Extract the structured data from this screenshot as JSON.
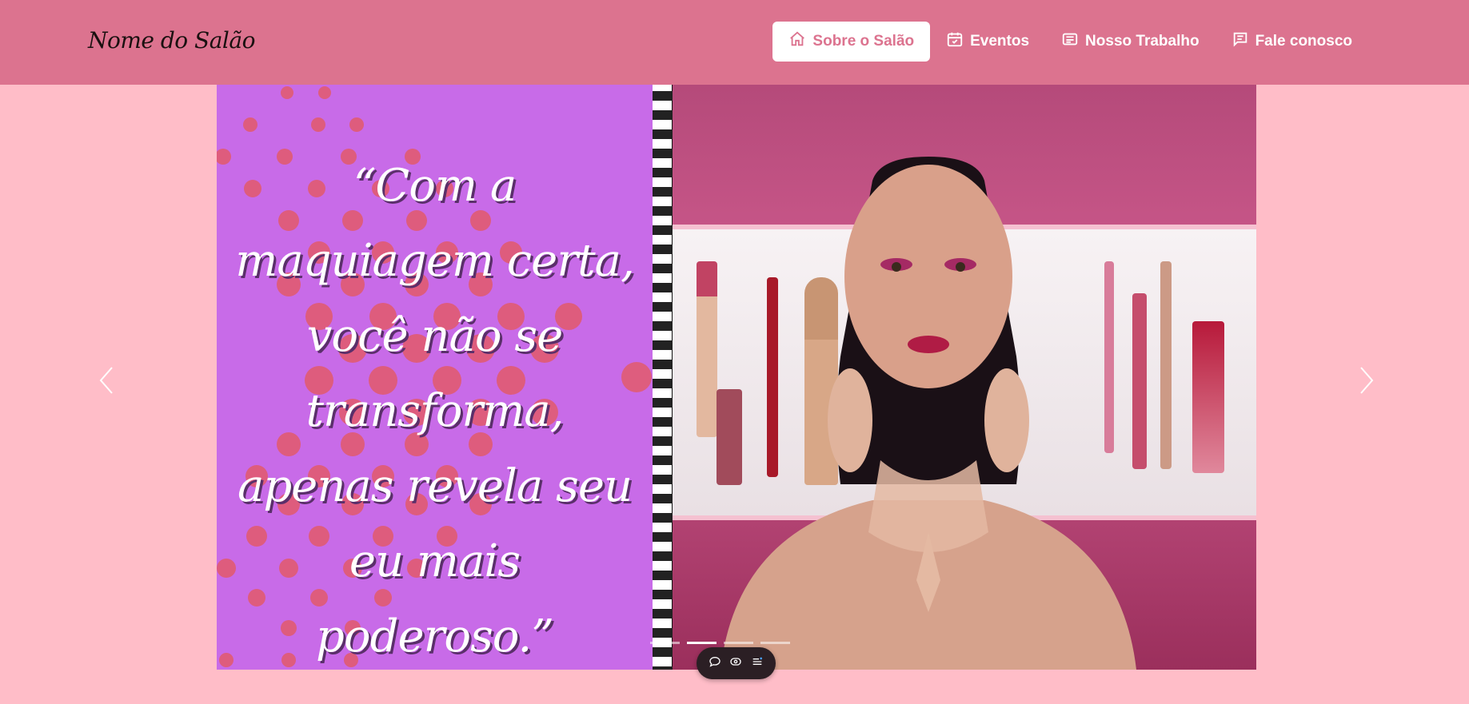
{
  "header": {
    "brand": "Nome do Salão",
    "nav": [
      {
        "label": "Sobre o Salão",
        "icon": "home-icon",
        "active": true
      },
      {
        "label": "Eventos",
        "icon": "calendar-check-icon",
        "active": false
      },
      {
        "label": "Nosso Trabalho",
        "icon": "newspaper-icon",
        "active": false
      },
      {
        "label": "Fale conosco",
        "icon": "chat-icon",
        "active": false
      }
    ]
  },
  "carousel": {
    "quote": "“Com a maquiagem certa, você não se transforma, apenas revela seu eu mais poderoso.”",
    "prev_icon": "chevron-left-icon",
    "next_icon": "chevron-right-icon",
    "indicators_count": 4,
    "active_indicator": 1
  },
  "toolbar": {
    "icons": [
      "comment-icon",
      "eye-icon",
      "list-icon"
    ]
  },
  "colors": {
    "navbar": "#dc738f",
    "page_background": "#ffbdc8",
    "quote_panel": "#c86be8",
    "active_nav_text": "#dc738f"
  }
}
